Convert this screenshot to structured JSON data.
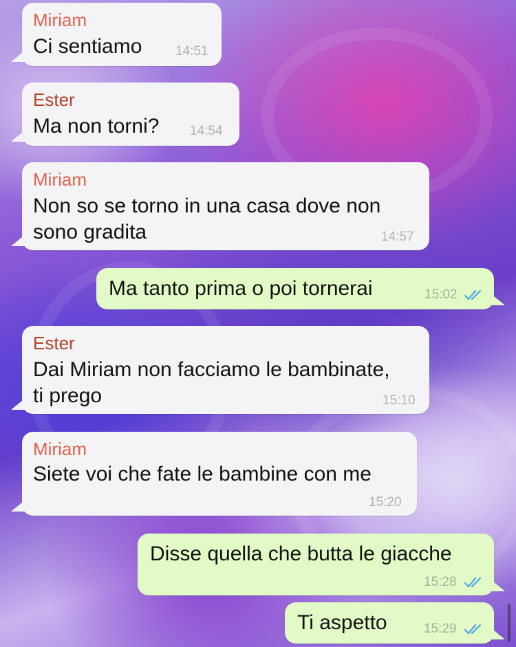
{
  "messages": [
    {
      "sender": "Miriam",
      "text": "Ci sentiamo",
      "time": "14:51"
    },
    {
      "sender": "Ester",
      "text": "Ma non torni?",
      "time": "14:54"
    },
    {
      "sender": "Miriam",
      "text_line1": "Non so se torno in una casa dove non",
      "text_line2": "sono gradita",
      "time": "14:57"
    },
    {
      "text": "Ma tanto prima o poi tornerai",
      "time": "15:02"
    },
    {
      "sender": "Ester",
      "text_line1": "Dai Miriam non facciamo le bambinate,",
      "text_line2": "ti prego",
      "time": "15:10"
    },
    {
      "sender": "Miriam",
      "text": "Siete voi che fate le bambine con me",
      "time": "15:20"
    },
    {
      "text": "Disse quella che butta le giacche",
      "time": "15:28"
    },
    {
      "text": "Ti aspetto",
      "time": "15:29"
    }
  ],
  "colors": {
    "incoming_bubble": "#f4f4f6",
    "outgoing_bubble": "#e2fac6",
    "sender_miriam": "#e0634d",
    "sender_ester": "#b0442a",
    "read_ticks": "#4fa3e8"
  },
  "icons": {
    "read_receipt": "double-check-icon"
  }
}
